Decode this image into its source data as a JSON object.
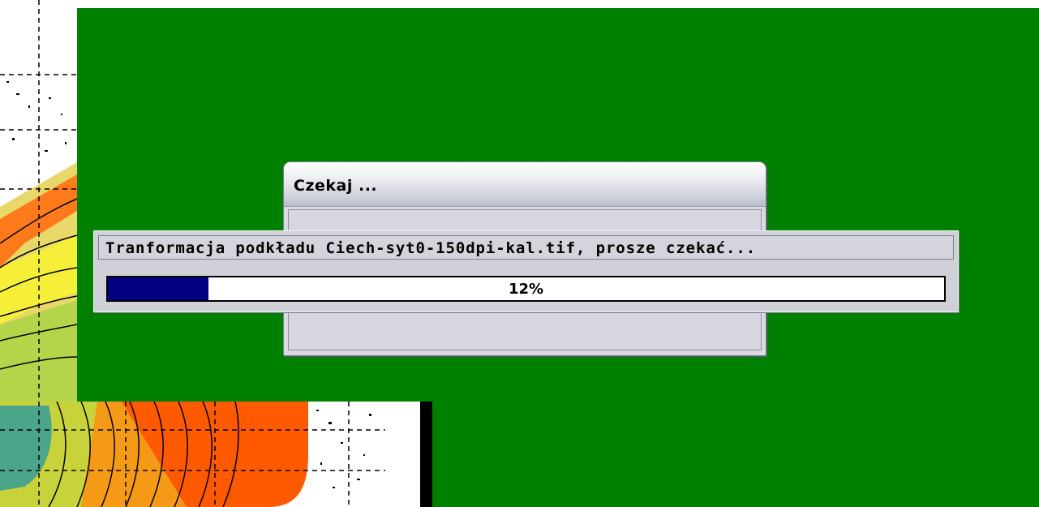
{
  "colors": {
    "overlay_green": "#008000",
    "progress_fill": "#000080",
    "dialog_bg": "#dadbe2"
  },
  "dialog": {
    "title": "Czekaj ..."
  },
  "progress": {
    "message": "Tranformacja podkładu Ciech-syt0-150dpi-kal.tif, prosze czekać...",
    "percent": 12,
    "percent_label": "12%"
  }
}
